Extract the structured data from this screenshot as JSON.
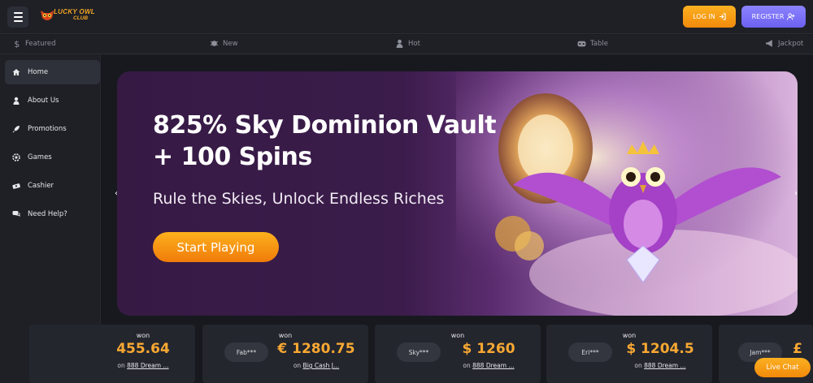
{
  "header": {
    "logo_text": "LUCKY OWL",
    "logo_sub": "CLUB",
    "login_label": "LOG IN",
    "register_label": "REGISTER",
    "accent_orange": "#f7a11a",
    "accent_purple": "#7b72fa"
  },
  "categories": [
    {
      "label": "Featured",
      "icon": "dollar-icon"
    },
    {
      "label": "New",
      "icon": "bug-icon"
    },
    {
      "label": "Hot",
      "icon": "person-icon"
    },
    {
      "label": "Table",
      "icon": "gamepad-icon"
    },
    {
      "label": "Jackpot",
      "icon": "megaphone-icon"
    }
  ],
  "sidebar": {
    "items": [
      {
        "label": "Home",
        "icon": "home-icon",
        "active": true
      },
      {
        "label": "About Us",
        "icon": "user-icon"
      },
      {
        "label": "Promotions",
        "icon": "rocket-icon"
      },
      {
        "label": "Games",
        "icon": "chip-icon"
      },
      {
        "label": "Cashier",
        "icon": "money-icon"
      },
      {
        "label": "Need Help?",
        "icon": "chat-icon"
      }
    ]
  },
  "hero": {
    "title": "825% Sky Dominion Vault + 100 Spins",
    "subtitle": "Rule the Skies, Unlock Endless Riches",
    "cta": "Start Playing"
  },
  "wins": [
    {
      "won": "won",
      "user": "",
      "amount": "455.64",
      "on": "on",
      "game": "888 Dream ..."
    },
    {
      "won": "won",
      "user": "Fab***",
      "amount": "€ 1280.75",
      "on": "on",
      "game": "Big Cash J..."
    },
    {
      "won": "won",
      "user": "Sky***",
      "amount": "$ 1260",
      "on": "on",
      "game": "888 Dream ..."
    },
    {
      "won": "won",
      "user": "Eri***",
      "amount": "$ 1204.5",
      "on": "on",
      "game": "888 Dream ..."
    },
    {
      "won": "",
      "user": "Jam***",
      "amount": "£",
      "on": "",
      "game": ""
    }
  ],
  "live_chat": "Live Chat"
}
